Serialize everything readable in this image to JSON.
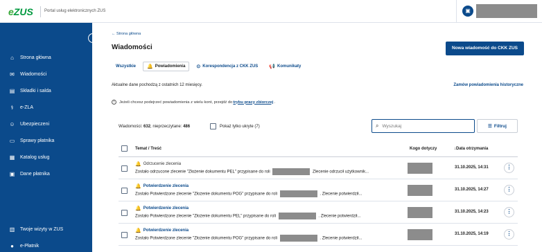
{
  "header": {
    "logo_e": "e",
    "logo_zus": "ZUS",
    "portal_name": "Portal usług elektronicznych ZUS"
  },
  "sidebar": {
    "items": [
      {
        "label": "Strona główna",
        "icon": "home-icon",
        "glyph": "⌂"
      },
      {
        "label": "Wiadomości",
        "icon": "mail-icon",
        "glyph": "✉"
      },
      {
        "label": "Składki i salda",
        "icon": "ledger-icon",
        "glyph": "▤"
      },
      {
        "label": "e-ZLA",
        "icon": "medical-icon",
        "glyph": "⚕"
      },
      {
        "label": "Ubezpieczeni",
        "icon": "people-icon",
        "glyph": "☺"
      },
      {
        "label": "Sprawy płatnika",
        "icon": "folder-icon",
        "glyph": "▭"
      },
      {
        "label": "Katalog usług",
        "icon": "catalog-icon",
        "glyph": "▦"
      },
      {
        "label": "Dane płatnika",
        "icon": "id-card-icon",
        "glyph": "▣"
      },
      {
        "label": "Twoje wizyty w ZUS",
        "icon": "calendar-icon",
        "glyph": "▥"
      },
      {
        "label": "e-Płatnik",
        "icon": "user-icon",
        "glyph": "●"
      }
    ]
  },
  "main": {
    "back_link": "← Strona główna",
    "title": "Wiadomości",
    "new_button": "Nowa wiadomość do CKK ZUS",
    "tabs": [
      {
        "label": "Wszystkie",
        "icon": ""
      },
      {
        "label": "Powiadomienia",
        "icon": "🔔"
      },
      {
        "label": "Korespondencja z CKK ZUS",
        "icon": "⊙"
      },
      {
        "label": "Komunikaty",
        "icon": "📢"
      }
    ],
    "info_age": "Aktualne dane pochodzą z ostatnich 12 miesięcy.",
    "history_link": "Zamów powiadomienia historyczne",
    "info_prefix": "Jeżeli chcesz podejrzeć powiadomienia z wielu kont, przejdź do",
    "info_link": "trybu pracy zbiorczej",
    "info_suffix": ".",
    "stats_label": "Wiadomości:",
    "stats_total": "632",
    "stats_unread_label": ", nieprzeczytane:",
    "stats_unread": "486",
    "show_hidden_label": "Pokaż tylko ukryte (7)",
    "search_placeholder": "Wyszukaj",
    "filter_label": "Filtruj",
    "columns": {
      "subject": "Temat / Treść",
      "who": "Kogo dotyczy",
      "date": "↓Data otrzymania"
    },
    "rows": [
      {
        "subject": "Odrzucenie zlecenia",
        "unread": false,
        "body_before": "Zostało odrzucone zlecenie \"Złożenie dokumentu PEL\" przypisane do roli",
        "body_after": "Zlecenie odrzucił użytkownik...",
        "date": "31.10.2025, 14:31"
      },
      {
        "subject": "Potwierdzenie zlecenia",
        "unread": true,
        "body_before": "Zostało Potwierdzone zlecenie \"Złożenie dokumentu POG\" przypisane do roli",
        "body_after": ". Zlecenie potwierdził...",
        "date": "31.10.2025, 14:27"
      },
      {
        "subject": "Potwierdzenie zlecenia",
        "unread": true,
        "body_before": "Zostało Potwierdzone zlecenie \"Złożenie dokumentu PEL\" przypisane do roli",
        "body_after": ". Zlecenie potwierdził...",
        "date": "31.10.2025, 14:23"
      },
      {
        "subject": "Potwierdzenie zlecenia",
        "unread": true,
        "body_before": "Zostało Potwierdzone zlecenie \"Złożenie dokumentu POG\" przypisane do roli",
        "body_after": ". Zlecenie potwierdził...",
        "date": "31.10.2025, 14:19"
      }
    ]
  }
}
